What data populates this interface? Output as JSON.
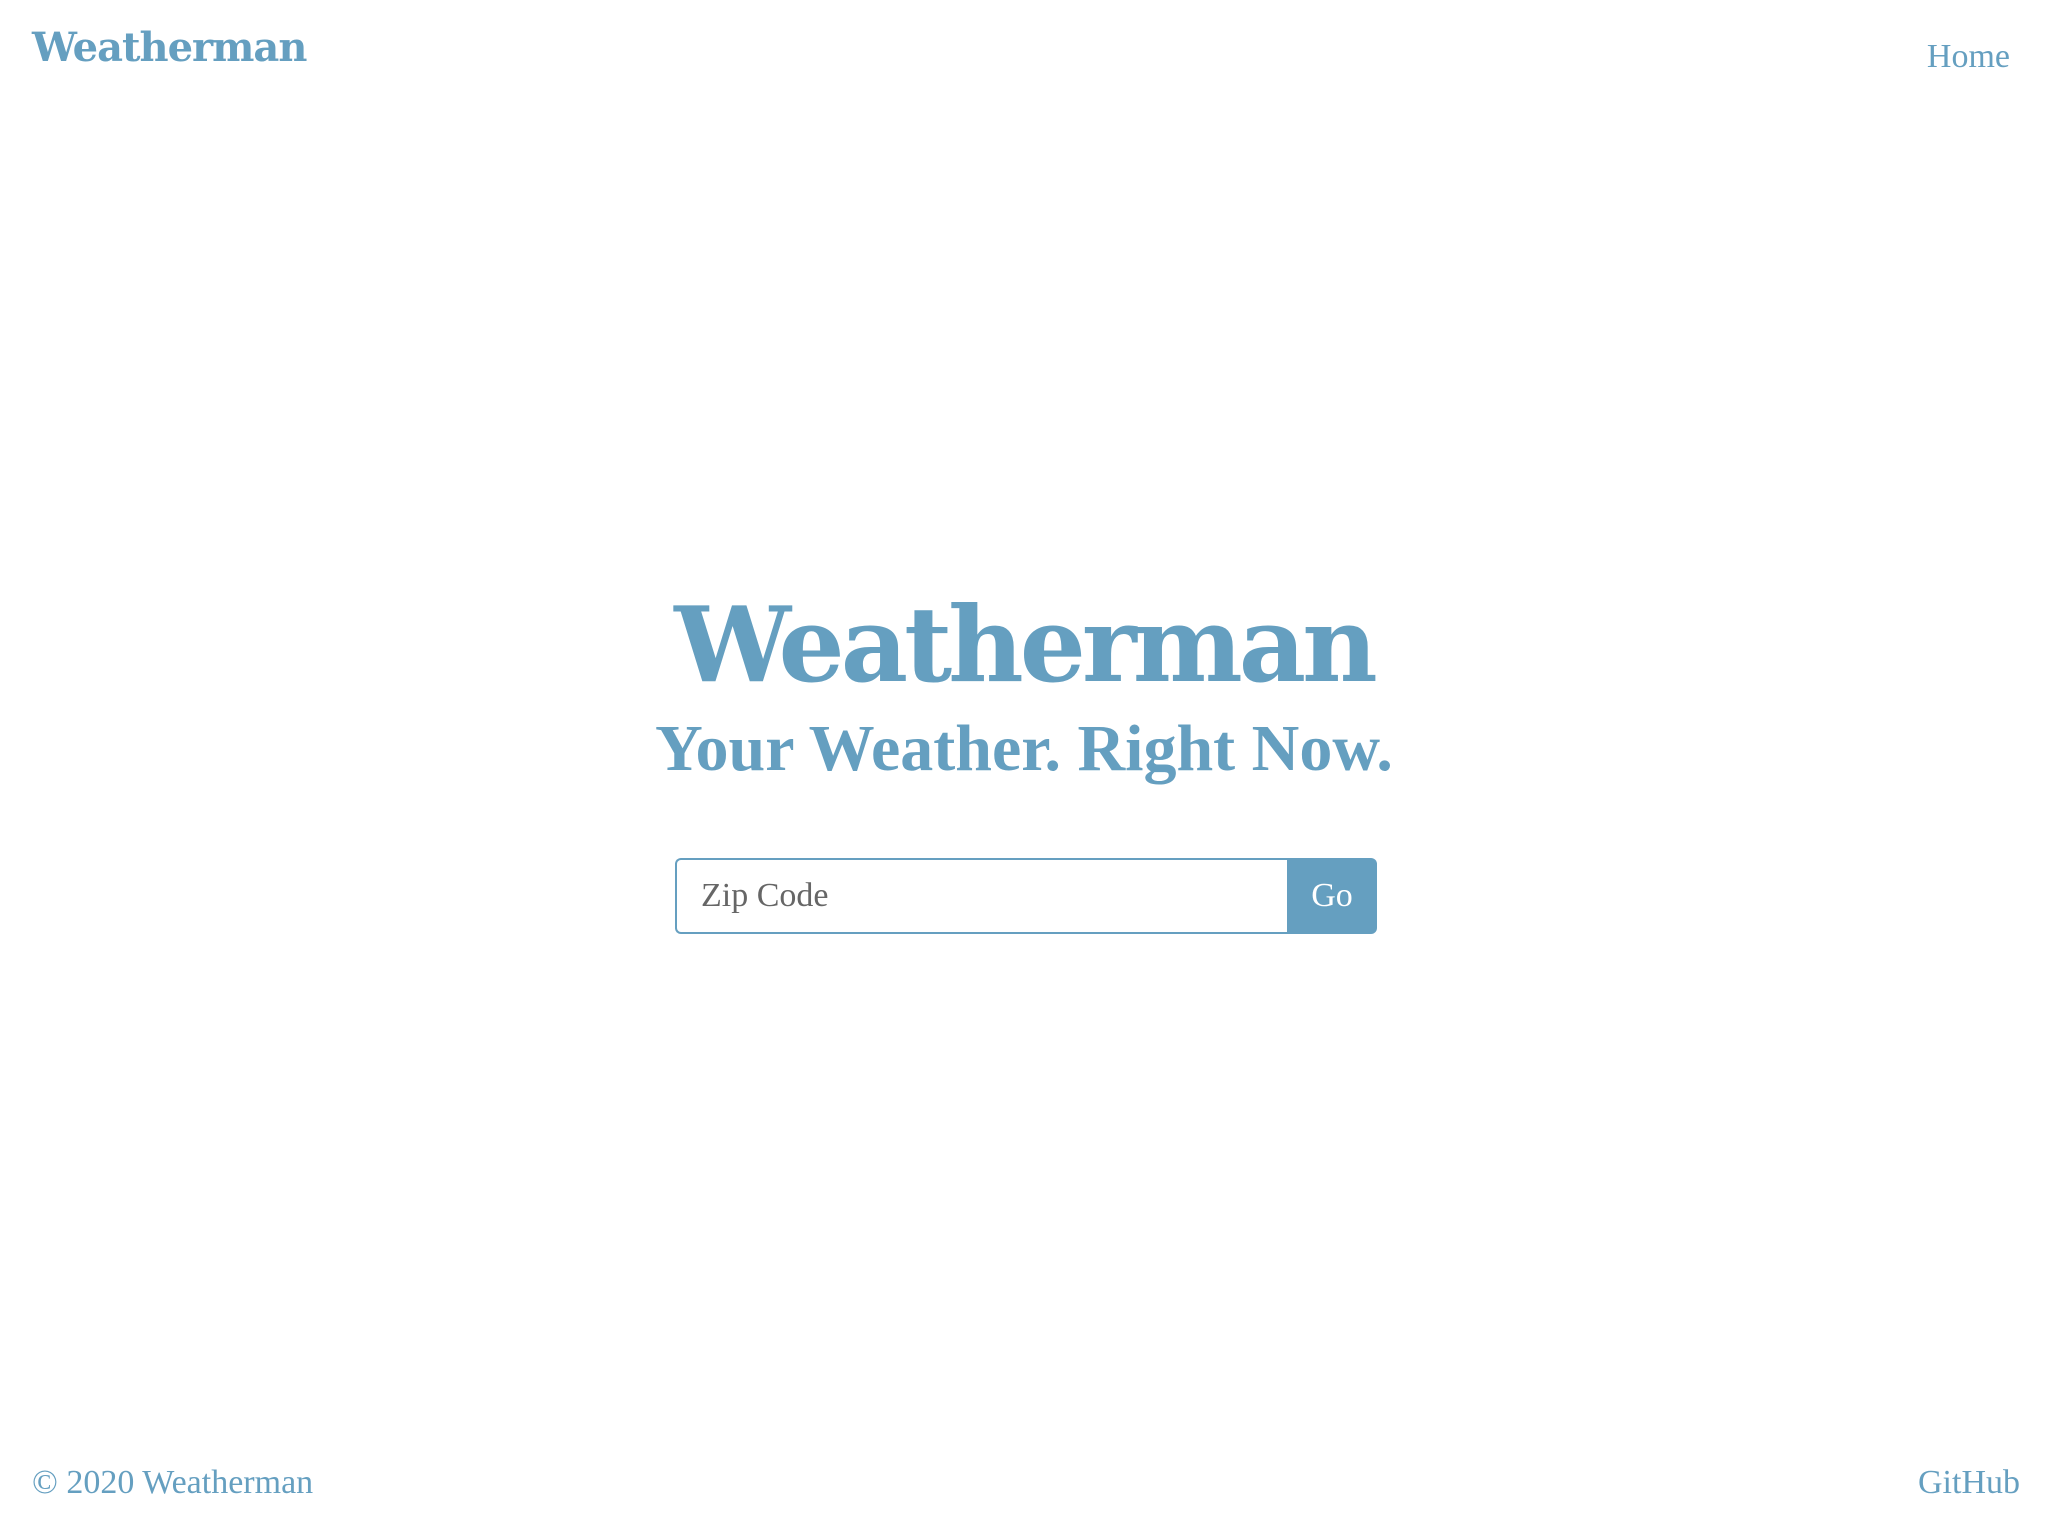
{
  "nav": {
    "brand": "Weatherman",
    "links": [
      {
        "label": "Home"
      }
    ]
  },
  "hero": {
    "title": "Weatherman",
    "subtitle": "Your Weather. Right Now."
  },
  "search": {
    "placeholder": "Zip Code",
    "value": "",
    "button_label": "Go"
  },
  "footer": {
    "copyright": "© 2020 Weatherman",
    "github_label": "GitHub"
  },
  "colors": {
    "accent": "#659fc0",
    "background": "#ffffff",
    "button_text": "#ffffff"
  }
}
